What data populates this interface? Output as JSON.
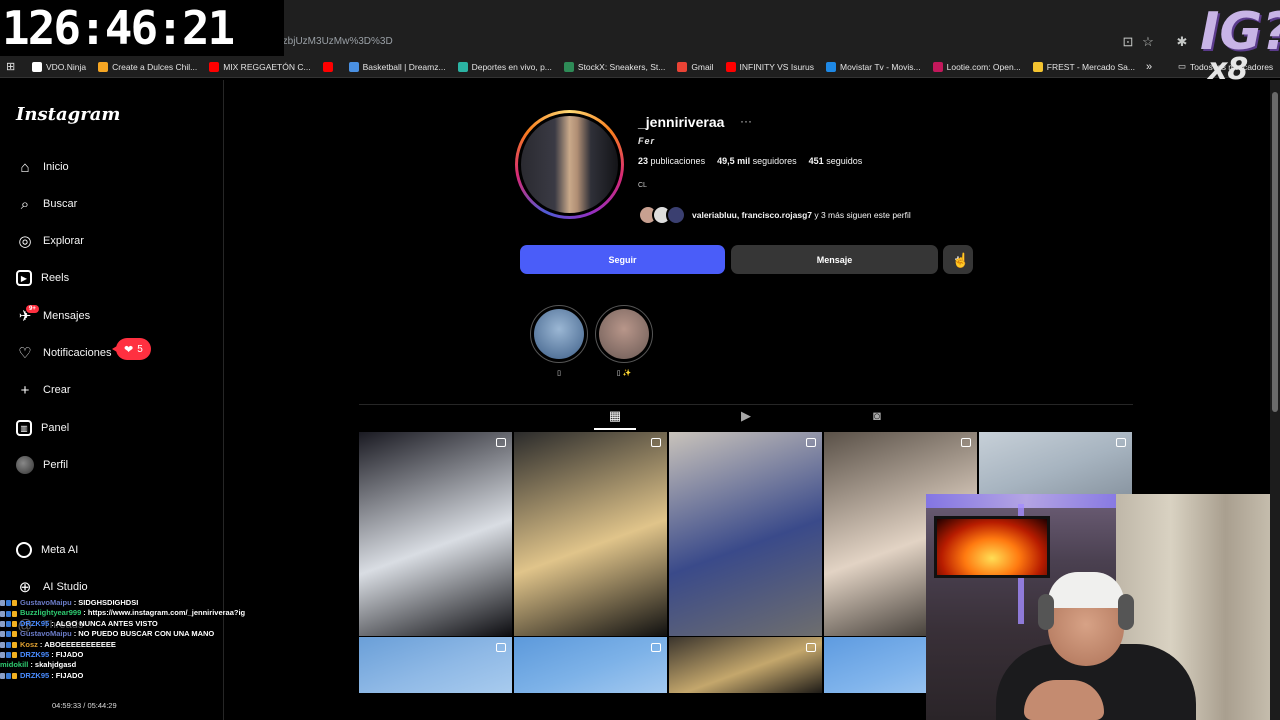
{
  "timer": "126:46:21",
  "browser": {
    "url_fragment": "EzbjUzM3UzMw%3D%3D",
    "bookmarks": [
      {
        "label": "VDO.Ninja",
        "color": "#ffffff"
      },
      {
        "label": "Create a Dulces Chil...",
        "color": "#f6a623"
      },
      {
        "label": "MIX REGGAETÓN C...",
        "color": "#ff0000"
      },
      {
        "label": "",
        "color": "#ff0000"
      },
      {
        "label": "Basketball | Dreamz...",
        "color": "#4a90e2"
      },
      {
        "label": "Deportes en vivo, p...",
        "color": "#2bb3a3"
      },
      {
        "label": "StockX: Sneakers, St...",
        "color": "#2e8b57"
      },
      {
        "label": "Gmail",
        "color": "#ea4335"
      },
      {
        "label": "INFINITY VS Isurus",
        "color": "#ff0000"
      },
      {
        "label": "Movistar Tv - Movis...",
        "color": "#1e88e5"
      },
      {
        "label": "Lootie.com: Open...",
        "color": "#c2185b"
      },
      {
        "label": "FREST - Mercado Sa...",
        "color": "#f4c430"
      }
    ],
    "folder_label": "Todos los marcadores"
  },
  "overlay_logo": {
    "text": "IG?",
    "sub": "x8"
  },
  "sidebar": {
    "brand": "Instagram",
    "items": [
      {
        "label": "Inicio",
        "icon": "home-icon"
      },
      {
        "label": "Buscar",
        "icon": "search-icon"
      },
      {
        "label": "Explorar",
        "icon": "compass-icon"
      },
      {
        "label": "Reels",
        "icon": "reels-icon"
      },
      {
        "label": "Mensajes",
        "icon": "messenger-icon"
      },
      {
        "label": "Notificaciones",
        "icon": "heart-icon"
      },
      {
        "label": "Crear",
        "icon": "plus-icon"
      },
      {
        "label": "Panel",
        "icon": "dashboard-icon"
      },
      {
        "label": "Perfil",
        "icon": "avatar-icon"
      },
      {
        "label": "Meta AI",
        "icon": "meta-ai-icon"
      },
      {
        "label": "AI Studio",
        "icon": "ai-studio-icon"
      },
      {
        "label": "Threads",
        "icon": "threads-icon"
      }
    ],
    "messages_badge": "9+",
    "notifications_badge": "5"
  },
  "profile": {
    "username": "_jenniriveraa",
    "more_dots": "···",
    "full_name": "Fer",
    "stats": {
      "posts_count": "23",
      "posts_label": "publicaciones",
      "followers_count": "49,5 mil",
      "followers_label": "seguidores",
      "following_count": "451",
      "following_label": "seguidos"
    },
    "bio": "CL",
    "mutuals_names": "valeriabluu, francisco.rojasg7",
    "mutuals_suffix": " y 3 más siguen este perfil",
    "follow_button": "Seguir",
    "message_button": "Mensaje",
    "more_button": "+",
    "highlights": [
      {
        "label": "▯",
        "colors": [
          "#9bb7d4",
          "#3e5f88"
        ]
      },
      {
        "label": "▯ ✨",
        "colors": [
          "#b8968a",
          "#6b5a55"
        ]
      }
    ]
  },
  "posts": [
    {
      "colors": [
        "#1a1a22",
        "#d9dde3",
        "#0c0c10"
      ]
    },
    {
      "colors": [
        "#2b2b2b",
        "#e0c48a",
        "#101010"
      ]
    },
    {
      "colors": [
        "#c9c3bb",
        "#3a4a8a",
        "#6e6e6e"
      ]
    },
    {
      "colors": [
        "#5a5148",
        "#e2d3c4",
        "#2a2622"
      ]
    },
    {
      "colors": [
        "#c7d0d8",
        "#a7b4c0",
        "#8a96a2"
      ]
    },
    {
      "colors": [
        "#6a9fd8",
        "#8fb9e6",
        "#a8cbee"
      ]
    },
    {
      "colors": [
        "#5c99db",
        "#7db2e8",
        "#a3c9f0"
      ]
    },
    {
      "colors": [
        "#3b352d",
        "#c4a76c",
        "#1e1b17"
      ]
    },
    {
      "colors": [
        "#5e9be0",
        "#80b4ec",
        "#a5cbf2"
      ]
    }
  ],
  "chat": [
    {
      "user": "GustavoMaipu",
      "msg": " : SIDGHSDIGHDSI",
      "color": "#6b7cc8"
    },
    {
      "user": "Buzzlightyear999",
      "msg": " : https://www.instagram.com/_jenniriveraa?ig",
      "color": "#2ecc71"
    },
    {
      "user": "DRZK95",
      "msg": " : ALGO NUNCA ANTES VISTO",
      "color": "#4a8cff"
    },
    {
      "user": "GustavoMaipu",
      "msg": " : NO PUEDO BUSCAR CON UNA MANO",
      "color": "#6b7cc8"
    },
    {
      "user": "Kosz",
      "msg": " : ABOEEEEEEEEEEE",
      "color": "#e0a030"
    },
    {
      "user": "DRZK95",
      "msg": " : FIJADO",
      "color": "#4a8cff"
    },
    {
      "user": "midokill",
      "msg": " : skahjdgasd",
      "color": "#2ecc71"
    },
    {
      "user": "DRZK95",
      "msg": " : FIJADO",
      "color": "#4a8cff"
    }
  ],
  "player_time": "04:59:33 / 05:44:29"
}
